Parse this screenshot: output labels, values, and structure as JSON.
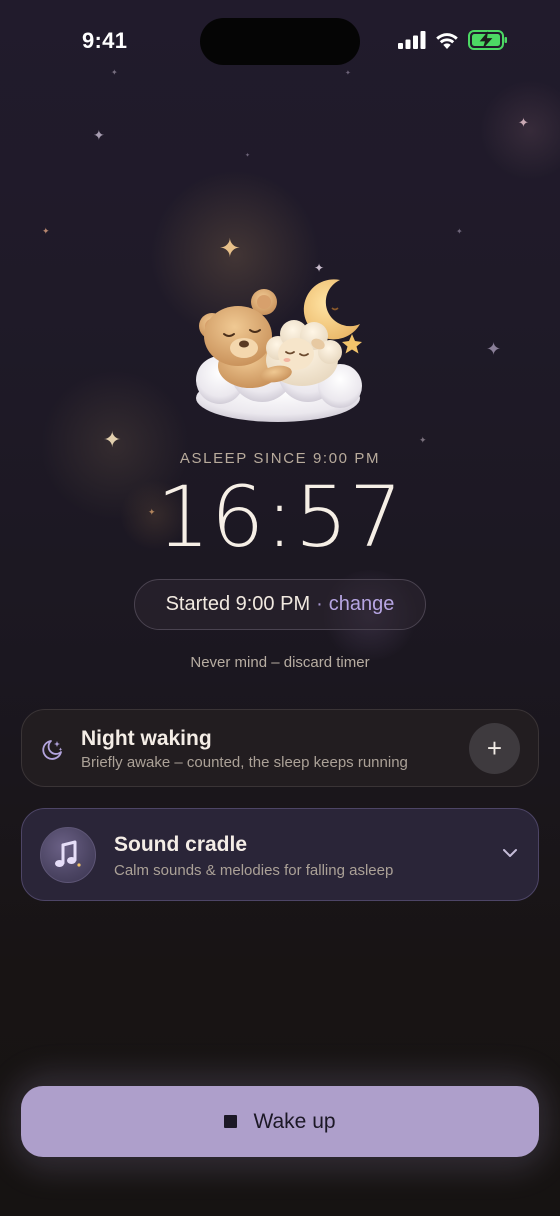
{
  "status_bar": {
    "time": "9:41",
    "icons": [
      "cellular-signal-icon",
      "wifi-icon",
      "battery-charging-icon"
    ],
    "battery_color": "#4cd964"
  },
  "hero": {
    "illustration": "sleeping-teddy-bear-and-lamb-on-cloud-with-moon"
  },
  "timer": {
    "since_label": "ASLEEP SINCE 9:00 PM",
    "elapsed": "16:57",
    "started_text": "Started 9:00 PM",
    "separator": "·",
    "change_link": "change",
    "discard_link": "Never mind – discard timer"
  },
  "night_waking": {
    "icon": "moon-stars-icon",
    "title": "Night waking",
    "subtitle": "Briefly awake – counted, the sleep keeps running",
    "add_label": "+"
  },
  "sound_cradle": {
    "icon": "music-note-icon",
    "title": "Sound cradle",
    "subtitle": "Calm sounds & melodies for falling asleep",
    "expand_icon": "chevron-down-icon"
  },
  "wake_button": {
    "label": "Wake up",
    "icon": "stop-icon"
  },
  "colors": {
    "accent": "#b6a5e2",
    "button": "#ae9fcb",
    "background_top": "#211b2c",
    "background_bottom": "#161312"
  }
}
